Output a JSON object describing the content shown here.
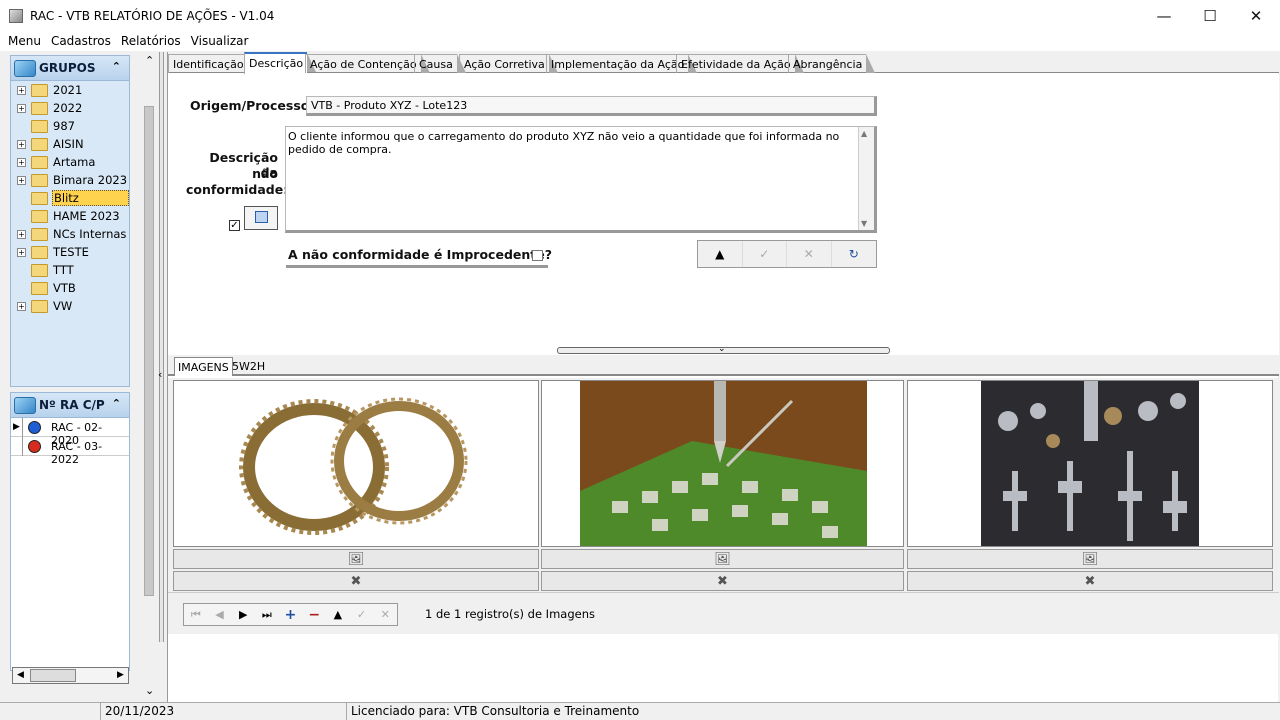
{
  "window": {
    "title": "RAC - VTB  RELATÓRIO DE AÇÕES - V1.04",
    "minimize": "—",
    "maximize": "☐",
    "close": "✕"
  },
  "menu": [
    "Menu",
    "Cadastros",
    "Relatórios",
    "Visualizar"
  ],
  "groups_panel": {
    "title": "GRUPOS",
    "items": [
      {
        "label": "2021",
        "expandable": true
      },
      {
        "label": "2022",
        "expandable": true
      },
      {
        "label": "987",
        "expandable": false
      },
      {
        "label": "AISIN",
        "expandable": true
      },
      {
        "label": "Artama",
        "expandable": true
      },
      {
        "label": "Bimara 2023",
        "expandable": true
      },
      {
        "label": "Blitz",
        "expandable": false,
        "selected": true
      },
      {
        "label": "HAME 2023",
        "expandable": false
      },
      {
        "label": "NCs Internas",
        "expandable": true
      },
      {
        "label": "TESTE",
        "expandable": true
      },
      {
        "label": "TTT",
        "expandable": false
      },
      {
        "label": "VTB",
        "expandable": false
      },
      {
        "label": "VW",
        "expandable": true
      }
    ]
  },
  "ra_panel": {
    "title": "Nº RA C/P",
    "items": [
      {
        "label": "RAC - 02-2020",
        "color": "#1f5fd6",
        "current": true
      },
      {
        "label": "RAC - 03-2022",
        "color": "#d62b1f",
        "current": false
      }
    ]
  },
  "tabs": [
    {
      "label": "Identificação",
      "active": false
    },
    {
      "label": "Descrição",
      "active": true
    },
    {
      "label": "Ação de Contenção",
      "active": false
    },
    {
      "label": "Causa",
      "active": false
    },
    {
      "label": "Ação Corretiva",
      "active": false
    },
    {
      "label": "Implementação da Ação",
      "active": false
    },
    {
      "label": "Efetividade da Ação",
      "active": false
    },
    {
      "label": "Abrangência",
      "active": false
    }
  ],
  "form": {
    "origin_label": "Origem/Processo:",
    "origin_value": "VTB - Produto XYZ - Lote123",
    "desc_label_1": "Descrição  da",
    "desc_label_2": "não",
    "desc_label_3": "conformidade:",
    "desc_value": "O cliente informou que o carregamento do produto XYZ não veio a quantidade que foi informada no pedido de compra.",
    "checkbox_checked": true,
    "improcedente_label": "A não conformidade é Improcedente?",
    "improcedente_checked": false
  },
  "subtabs": [
    {
      "label": "IMAGENS",
      "active": true
    },
    {
      "label": "5W2H",
      "active": false
    }
  ],
  "images": [
    {
      "alt": "anéis sincronizadores"
    },
    {
      "alt": "placa de circuito soldagem"
    },
    {
      "alt": "peças metálicas usinadas"
    }
  ],
  "record_count": "1 de 1 registro(s) de Imagens",
  "status": {
    "date": "20/11/2023",
    "license": "Licenciado para: VTB Consultoria e Treinamento"
  }
}
